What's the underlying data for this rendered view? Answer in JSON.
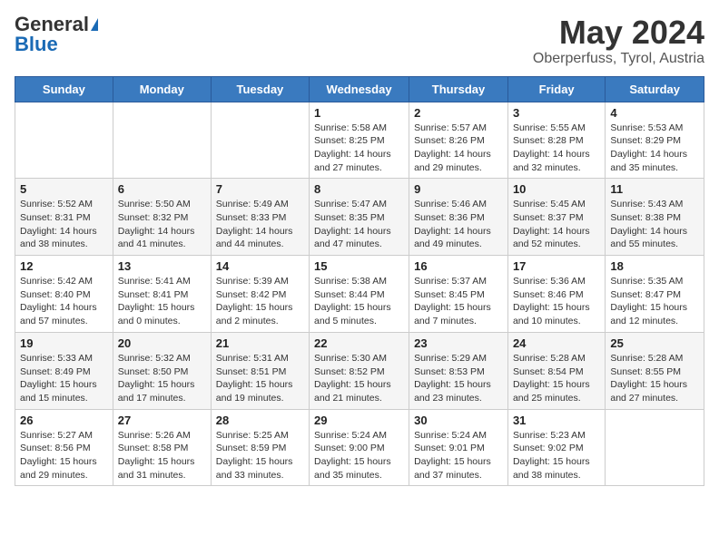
{
  "logo": {
    "general": "General",
    "blue": "Blue"
  },
  "title": {
    "month_year": "May 2024",
    "location": "Oberperfuss, Tyrol, Austria"
  },
  "days_of_week": [
    "Sunday",
    "Monday",
    "Tuesday",
    "Wednesday",
    "Thursday",
    "Friday",
    "Saturday"
  ],
  "weeks": [
    [
      {
        "day": "",
        "info": ""
      },
      {
        "day": "",
        "info": ""
      },
      {
        "day": "",
        "info": ""
      },
      {
        "day": "1",
        "info": "Sunrise: 5:58 AM\nSunset: 8:25 PM\nDaylight: 14 hours and 27 minutes."
      },
      {
        "day": "2",
        "info": "Sunrise: 5:57 AM\nSunset: 8:26 PM\nDaylight: 14 hours and 29 minutes."
      },
      {
        "day": "3",
        "info": "Sunrise: 5:55 AM\nSunset: 8:28 PM\nDaylight: 14 hours and 32 minutes."
      },
      {
        "day": "4",
        "info": "Sunrise: 5:53 AM\nSunset: 8:29 PM\nDaylight: 14 hours and 35 minutes."
      }
    ],
    [
      {
        "day": "5",
        "info": "Sunrise: 5:52 AM\nSunset: 8:31 PM\nDaylight: 14 hours and 38 minutes."
      },
      {
        "day": "6",
        "info": "Sunrise: 5:50 AM\nSunset: 8:32 PM\nDaylight: 14 hours and 41 minutes."
      },
      {
        "day": "7",
        "info": "Sunrise: 5:49 AM\nSunset: 8:33 PM\nDaylight: 14 hours and 44 minutes."
      },
      {
        "day": "8",
        "info": "Sunrise: 5:47 AM\nSunset: 8:35 PM\nDaylight: 14 hours and 47 minutes."
      },
      {
        "day": "9",
        "info": "Sunrise: 5:46 AM\nSunset: 8:36 PM\nDaylight: 14 hours and 49 minutes."
      },
      {
        "day": "10",
        "info": "Sunrise: 5:45 AM\nSunset: 8:37 PM\nDaylight: 14 hours and 52 minutes."
      },
      {
        "day": "11",
        "info": "Sunrise: 5:43 AM\nSunset: 8:38 PM\nDaylight: 14 hours and 55 minutes."
      }
    ],
    [
      {
        "day": "12",
        "info": "Sunrise: 5:42 AM\nSunset: 8:40 PM\nDaylight: 14 hours and 57 minutes."
      },
      {
        "day": "13",
        "info": "Sunrise: 5:41 AM\nSunset: 8:41 PM\nDaylight: 15 hours and 0 minutes."
      },
      {
        "day": "14",
        "info": "Sunrise: 5:39 AM\nSunset: 8:42 PM\nDaylight: 15 hours and 2 minutes."
      },
      {
        "day": "15",
        "info": "Sunrise: 5:38 AM\nSunset: 8:44 PM\nDaylight: 15 hours and 5 minutes."
      },
      {
        "day": "16",
        "info": "Sunrise: 5:37 AM\nSunset: 8:45 PM\nDaylight: 15 hours and 7 minutes."
      },
      {
        "day": "17",
        "info": "Sunrise: 5:36 AM\nSunset: 8:46 PM\nDaylight: 15 hours and 10 minutes."
      },
      {
        "day": "18",
        "info": "Sunrise: 5:35 AM\nSunset: 8:47 PM\nDaylight: 15 hours and 12 minutes."
      }
    ],
    [
      {
        "day": "19",
        "info": "Sunrise: 5:33 AM\nSunset: 8:49 PM\nDaylight: 15 hours and 15 minutes."
      },
      {
        "day": "20",
        "info": "Sunrise: 5:32 AM\nSunset: 8:50 PM\nDaylight: 15 hours and 17 minutes."
      },
      {
        "day": "21",
        "info": "Sunrise: 5:31 AM\nSunset: 8:51 PM\nDaylight: 15 hours and 19 minutes."
      },
      {
        "day": "22",
        "info": "Sunrise: 5:30 AM\nSunset: 8:52 PM\nDaylight: 15 hours and 21 minutes."
      },
      {
        "day": "23",
        "info": "Sunrise: 5:29 AM\nSunset: 8:53 PM\nDaylight: 15 hours and 23 minutes."
      },
      {
        "day": "24",
        "info": "Sunrise: 5:28 AM\nSunset: 8:54 PM\nDaylight: 15 hours and 25 minutes."
      },
      {
        "day": "25",
        "info": "Sunrise: 5:28 AM\nSunset: 8:55 PM\nDaylight: 15 hours and 27 minutes."
      }
    ],
    [
      {
        "day": "26",
        "info": "Sunrise: 5:27 AM\nSunset: 8:56 PM\nDaylight: 15 hours and 29 minutes."
      },
      {
        "day": "27",
        "info": "Sunrise: 5:26 AM\nSunset: 8:58 PM\nDaylight: 15 hours and 31 minutes."
      },
      {
        "day": "28",
        "info": "Sunrise: 5:25 AM\nSunset: 8:59 PM\nDaylight: 15 hours and 33 minutes."
      },
      {
        "day": "29",
        "info": "Sunrise: 5:24 AM\nSunset: 9:00 PM\nDaylight: 15 hours and 35 minutes."
      },
      {
        "day": "30",
        "info": "Sunrise: 5:24 AM\nSunset: 9:01 PM\nDaylight: 15 hours and 37 minutes."
      },
      {
        "day": "31",
        "info": "Sunrise: 5:23 AM\nSunset: 9:02 PM\nDaylight: 15 hours and 38 minutes."
      },
      {
        "day": "",
        "info": ""
      }
    ]
  ]
}
